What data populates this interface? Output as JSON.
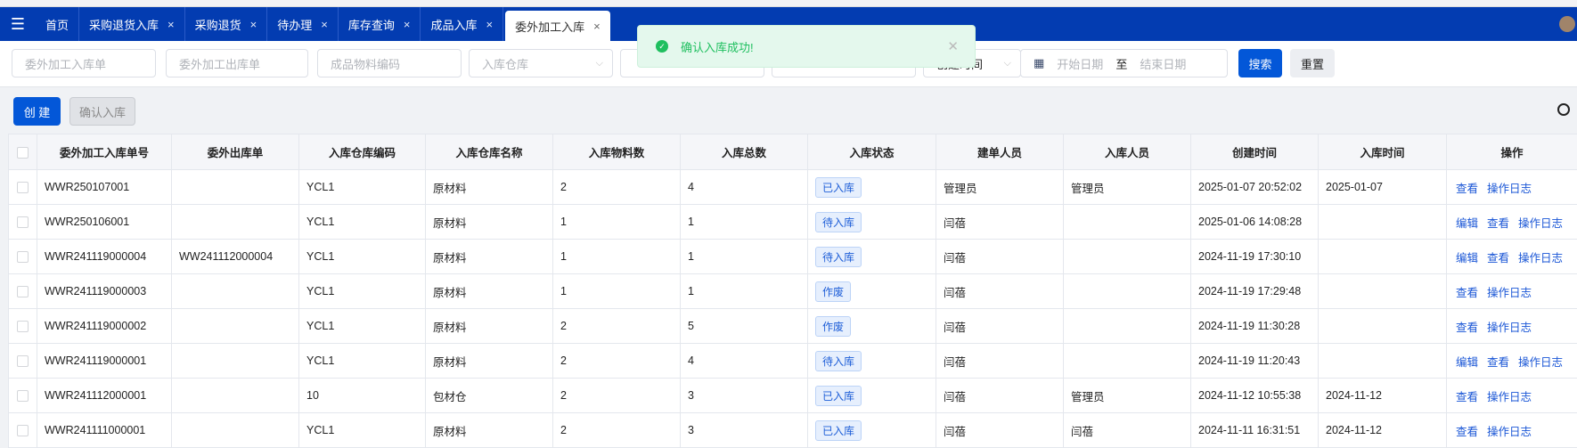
{
  "nav": {
    "tabs": [
      {
        "label": "首页",
        "closable": false
      },
      {
        "label": "采购退货入库",
        "closable": true
      },
      {
        "label": "采购退货",
        "closable": true
      },
      {
        "label": "待办理",
        "closable": true
      },
      {
        "label": "库存查询",
        "closable": true
      },
      {
        "label": "成品入库",
        "closable": true
      },
      {
        "label": "委外加工入库",
        "closable": true,
        "active": true
      }
    ],
    "close_glyph": "×"
  },
  "search": {
    "f1": "委外加工入库单",
    "f2": "委外加工出库单",
    "f3": "成品物料编码",
    "warehouse": "入库仓库",
    "time_type": "创建时间",
    "start": "开始日期",
    "to": "至",
    "end": "结束日期",
    "search": "搜索",
    "reset": "重置"
  },
  "toast": {
    "message": "确认入库成功!"
  },
  "actions": {
    "create": "创 建",
    "confirm": "确认入库"
  },
  "table": {
    "headers": [
      "委外加工入库单号",
      "委外出库单",
      "入库仓库编码",
      "入库仓库名称",
      "入库物料数",
      "入库总数",
      "入库状态",
      "建单人员",
      "入库人员",
      "创建时间",
      "入库时间",
      "操作"
    ],
    "rows": [
      [
        "WWR250107001",
        "",
        "YCL1",
        "原材料",
        "2",
        "4",
        "已入库",
        "管理员",
        "管理员",
        "2025-01-07 20:52:02",
        "2025-01-07",
        [
          "查看",
          "操作日志"
        ]
      ],
      [
        "WWR250106001",
        "",
        "YCL1",
        "原材料",
        "1",
        "1",
        "待入库",
        "闫蓓",
        "",
        "2025-01-06 14:08:28",
        "",
        [
          "编辑",
          "查看",
          "操作日志"
        ]
      ],
      [
        "WWR241119000004",
        "WW241112000004",
        "YCL1",
        "原材料",
        "1",
        "1",
        "待入库",
        "闫蓓",
        "",
        "2024-11-19 17:30:10",
        "",
        [
          "编辑",
          "查看",
          "操作日志"
        ]
      ],
      [
        "WWR241119000003",
        "",
        "YCL1",
        "原材料",
        "1",
        "1",
        "作废",
        "闫蓓",
        "",
        "2024-11-19 17:29:48",
        "",
        [
          "查看",
          "操作日志"
        ]
      ],
      [
        "WWR241119000002",
        "",
        "YCL1",
        "原材料",
        "2",
        "5",
        "作废",
        "闫蓓",
        "",
        "2024-11-19 11:30:28",
        "",
        [
          "查看",
          "操作日志"
        ]
      ],
      [
        "WWR241119000001",
        "",
        "YCL1",
        "原材料",
        "2",
        "4",
        "待入库",
        "闫蓓",
        "",
        "2024-11-19 11:20:43",
        "",
        [
          "编辑",
          "查看",
          "操作日志"
        ]
      ],
      [
        "WWR241112000001",
        "",
        "10",
        "包材仓",
        "2",
        "3",
        "已入库",
        "闫蓓",
        "管理员",
        "2024-11-12 10:55:38",
        "2024-11-12",
        [
          "查看",
          "操作日志"
        ]
      ],
      [
        "WWR241111000001",
        "",
        "YCL1",
        "原材料",
        "2",
        "3",
        "已入库",
        "闫蓓",
        "闫蓓",
        "2024-11-11 16:31:51",
        "2024-11-12",
        [
          "查看",
          "操作日志"
        ]
      ]
    ]
  }
}
